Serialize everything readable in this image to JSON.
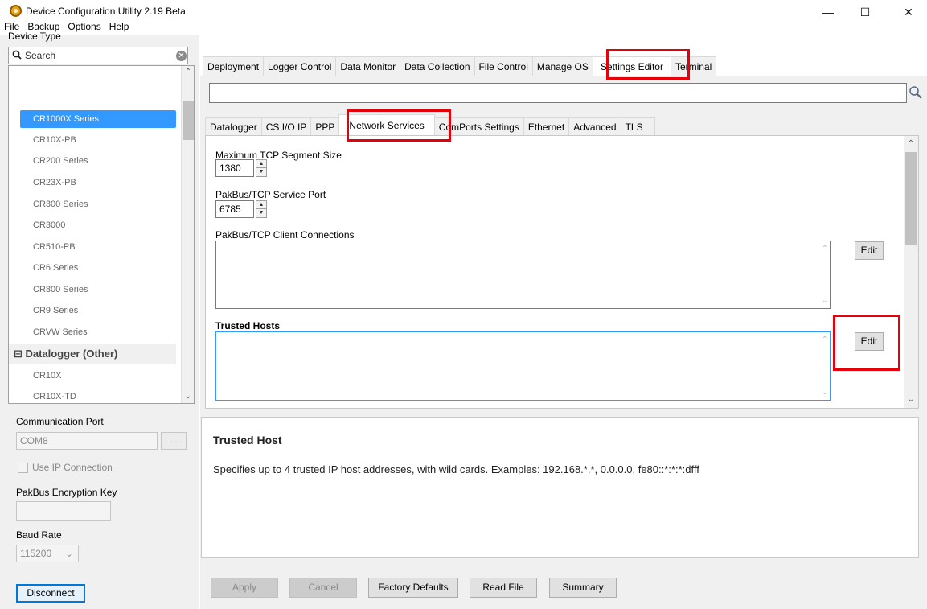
{
  "window": {
    "title": "Device Configuration Utility 2.19 Beta",
    "minimize": "—",
    "maximize": "☐",
    "close": "✕"
  },
  "menu": [
    "File",
    "Backup",
    "Options",
    "Help"
  ],
  "left_panel": {
    "device_type_label": "Device Type",
    "search_placeholder": "Search",
    "device_list": [
      "CR1000X Series",
      "CR10X-PB",
      "CR200 Series",
      "CR23X-PB",
      "CR300 Series",
      "CR3000",
      "CR510-PB",
      "CR6 Series",
      "CR800 Series",
      "CR9 Series",
      "CRVW Series"
    ],
    "selected_device": "CR1000X Series",
    "group_label": "⊟ Datalogger (Other)",
    "group_items": [
      "CR10X",
      "CR10X-TD"
    ],
    "communication_port_label": "Communication Port",
    "communication_port_value": "COM8",
    "browse_label": "...",
    "use_ip_label": "Use IP Connection",
    "encryption_label": "PakBus Encryption Key",
    "encryption_value": "",
    "baud_rate_label": "Baud Rate",
    "baud_rate_value": "115200",
    "disconnect_label": "Disconnect"
  },
  "main_tabs": [
    "Deployment",
    "Logger Control",
    "Data Monitor",
    "Data Collection",
    "File Control",
    "Manage OS",
    "Settings Editor",
    "Terminal"
  ],
  "active_main_tab": "Settings Editor",
  "sub_tabs": [
    "Datalogger",
    "CS I/O IP",
    "PPP",
    "Network Services",
    "ComPorts Settings",
    "Ethernet",
    "Advanced",
    "TLS"
  ],
  "active_sub_tab": "Network Services",
  "settings": {
    "max_tcp_label": "Maximum TCP Segment Size",
    "max_tcp_value": "1380",
    "service_port_label": "PakBus/TCP Service Port",
    "service_port_value": "6785",
    "client_conn_label": "PakBus/TCP Client Connections",
    "trusted_hosts_label": "Trusted Hosts",
    "edit_label": "Edit"
  },
  "help": {
    "title": "Trusted Host",
    "text": "Specifies up to 4 trusted IP host addresses, with wild cards. Examples: 192.168.*.*, 0.0.0.0, fe80::*:*:*:dfff"
  },
  "buttons": {
    "apply": "Apply",
    "cancel": "Cancel",
    "factory_defaults": "Factory Defaults",
    "read_file": "Read File",
    "summary": "Summary"
  },
  "colors": {
    "selection": "#3399ff",
    "highlight_box": "#e5000a",
    "accent": "#0078d7"
  }
}
